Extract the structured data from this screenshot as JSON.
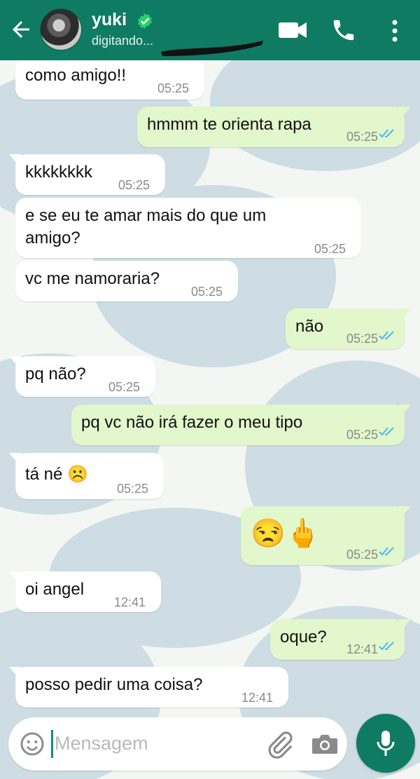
{
  "header": {
    "contact_name": "yuki",
    "status": "digitando..."
  },
  "messages": [
    {
      "dir": "in",
      "text": "como amigo!!",
      "time": "05:25"
    },
    {
      "dir": "out",
      "text": "hmmm te orienta rapa",
      "time": "05:25"
    },
    {
      "dir": "in",
      "text": "kkkkkkkk",
      "time": "05:25"
    },
    {
      "dir": "in",
      "text": "e se eu te amar mais do que um",
      "text2": "amigo?",
      "time": "05:25"
    },
    {
      "dir": "in",
      "text": "vc me namoraria?",
      "time": "05:25"
    },
    {
      "dir": "out",
      "text": "não",
      "time": "05:25"
    },
    {
      "dir": "in",
      "text": "pq não?",
      "time": "05:25"
    },
    {
      "dir": "out",
      "text": "pq vc não irá fazer o meu tipo",
      "time": "05:25"
    },
    {
      "dir": "in",
      "text": "tá né ☹️",
      "time": "05:25"
    },
    {
      "dir": "out",
      "text": "😒🖕",
      "time": "05:25"
    },
    {
      "dir": "in",
      "text": "oi angel",
      "time": "12:41"
    },
    {
      "dir": "out",
      "text": "oque?",
      "time": "12:41"
    },
    {
      "dir": "in",
      "text": "posso pedir uma coisa?",
      "time": "12:41"
    }
  ],
  "input": {
    "placeholder": "Mensagem"
  },
  "icons": {
    "back": "arrow-left-icon",
    "verified": "verified-check-icon",
    "video": "video-call-icon",
    "call": "phone-icon",
    "menu": "more-vert-icon",
    "emoji": "emoji-icon",
    "clip": "paperclip-icon",
    "camera": "camera-icon",
    "mic": "mic-icon"
  },
  "colors": {
    "header": "#0f7b63",
    "outgoing_bubble": "#e2f7cb",
    "incoming_bubble": "#ffffff",
    "read_ticks": "#4fb6ec",
    "verified": "#25d366"
  }
}
